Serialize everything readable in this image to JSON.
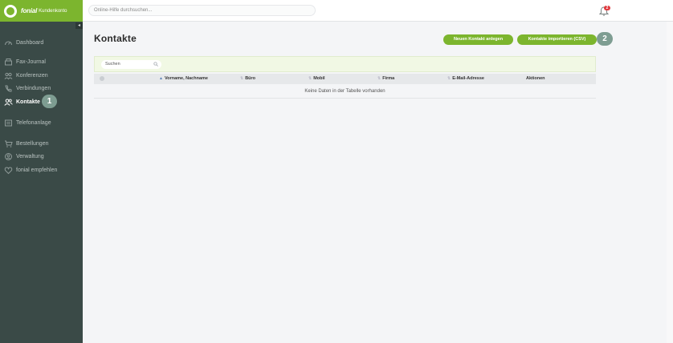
{
  "brand": {
    "name": "fonial",
    "subtitle": "Kundenkonto"
  },
  "header": {
    "search_placeholder": "Online-Hilfe durchsuchen...",
    "notification_count": "2"
  },
  "sidebar": {
    "collapse_glyph": "◂",
    "items": [
      {
        "label": "Dashboard",
        "icon": "dashboard-icon"
      },
      {
        "label": "Fax-Journal",
        "icon": "fax-icon"
      },
      {
        "label": "Konferenzen",
        "icon": "conference-icon"
      },
      {
        "label": "Verbindungen",
        "icon": "phone-icon"
      },
      {
        "label": "Kontakte",
        "icon": "contacts-icon",
        "active": true
      },
      {
        "label": "Telefonanlage",
        "icon": "pbx-icon"
      },
      {
        "label": "Bestellungen",
        "icon": "cart-icon"
      },
      {
        "label": "Verwaltung",
        "icon": "admin-icon"
      },
      {
        "label": "fonial empfehlen",
        "icon": "recommend-icon"
      }
    ],
    "step_badge": "1"
  },
  "main": {
    "title": "Kontakte",
    "buttons": {
      "new_contact": "Neuen Kontakt anlegen",
      "import_csv": "Kontakte importieren (CSV)"
    },
    "step_badge": "2",
    "table": {
      "search_placeholder": "Suchen",
      "columns": [
        "Vorname, Nachname",
        "Büro",
        "Mobil",
        "Firma",
        "E-Mail-Adresse",
        "Aktionen"
      ],
      "empty_message": "Keine Daten in der Tabelle vorhanden"
    }
  },
  "colors": {
    "accent": "#7cb52e",
    "sidebar": "#3a4a47",
    "badge": "#7e9d92",
    "alert": "#e0393e"
  }
}
